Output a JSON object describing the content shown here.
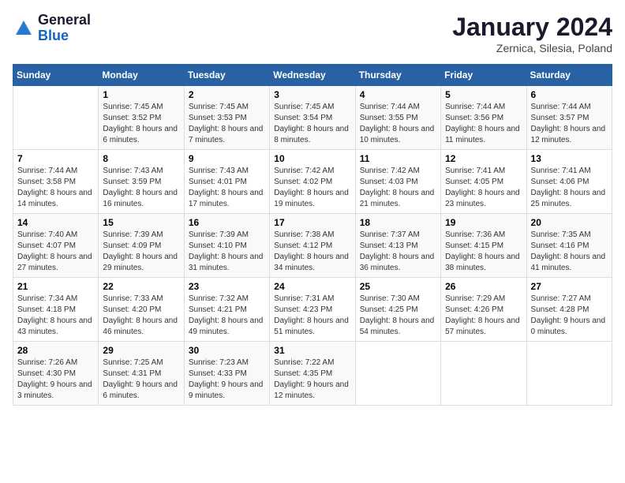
{
  "header": {
    "logo": {
      "general": "General",
      "blue": "Blue"
    },
    "title": "January 2024",
    "location": "Zernica, Silesia, Poland"
  },
  "columns": [
    "Sunday",
    "Monday",
    "Tuesday",
    "Wednesday",
    "Thursday",
    "Friday",
    "Saturday"
  ],
  "weeks": [
    [
      {
        "day": "",
        "sunrise": "",
        "sunset": "",
        "daylight": ""
      },
      {
        "day": "1",
        "sunrise": "Sunrise: 7:45 AM",
        "sunset": "Sunset: 3:52 PM",
        "daylight": "Daylight: 8 hours and 6 minutes."
      },
      {
        "day": "2",
        "sunrise": "Sunrise: 7:45 AM",
        "sunset": "Sunset: 3:53 PM",
        "daylight": "Daylight: 8 hours and 7 minutes."
      },
      {
        "day": "3",
        "sunrise": "Sunrise: 7:45 AM",
        "sunset": "Sunset: 3:54 PM",
        "daylight": "Daylight: 8 hours and 8 minutes."
      },
      {
        "day": "4",
        "sunrise": "Sunrise: 7:44 AM",
        "sunset": "Sunset: 3:55 PM",
        "daylight": "Daylight: 8 hours and 10 minutes."
      },
      {
        "day": "5",
        "sunrise": "Sunrise: 7:44 AM",
        "sunset": "Sunset: 3:56 PM",
        "daylight": "Daylight: 8 hours and 11 minutes."
      },
      {
        "day": "6",
        "sunrise": "Sunrise: 7:44 AM",
        "sunset": "Sunset: 3:57 PM",
        "daylight": "Daylight: 8 hours and 12 minutes."
      }
    ],
    [
      {
        "day": "7",
        "sunrise": "Sunrise: 7:44 AM",
        "sunset": "Sunset: 3:58 PM",
        "daylight": "Daylight: 8 hours and 14 minutes."
      },
      {
        "day": "8",
        "sunrise": "Sunrise: 7:43 AM",
        "sunset": "Sunset: 3:59 PM",
        "daylight": "Daylight: 8 hours and 16 minutes."
      },
      {
        "day": "9",
        "sunrise": "Sunrise: 7:43 AM",
        "sunset": "Sunset: 4:01 PM",
        "daylight": "Daylight: 8 hours and 17 minutes."
      },
      {
        "day": "10",
        "sunrise": "Sunrise: 7:42 AM",
        "sunset": "Sunset: 4:02 PM",
        "daylight": "Daylight: 8 hours and 19 minutes."
      },
      {
        "day": "11",
        "sunrise": "Sunrise: 7:42 AM",
        "sunset": "Sunset: 4:03 PM",
        "daylight": "Daylight: 8 hours and 21 minutes."
      },
      {
        "day": "12",
        "sunrise": "Sunrise: 7:41 AM",
        "sunset": "Sunset: 4:05 PM",
        "daylight": "Daylight: 8 hours and 23 minutes."
      },
      {
        "day": "13",
        "sunrise": "Sunrise: 7:41 AM",
        "sunset": "Sunset: 4:06 PM",
        "daylight": "Daylight: 8 hours and 25 minutes."
      }
    ],
    [
      {
        "day": "14",
        "sunrise": "Sunrise: 7:40 AM",
        "sunset": "Sunset: 4:07 PM",
        "daylight": "Daylight: 8 hours and 27 minutes."
      },
      {
        "day": "15",
        "sunrise": "Sunrise: 7:39 AM",
        "sunset": "Sunset: 4:09 PM",
        "daylight": "Daylight: 8 hours and 29 minutes."
      },
      {
        "day": "16",
        "sunrise": "Sunrise: 7:39 AM",
        "sunset": "Sunset: 4:10 PM",
        "daylight": "Daylight: 8 hours and 31 minutes."
      },
      {
        "day": "17",
        "sunrise": "Sunrise: 7:38 AM",
        "sunset": "Sunset: 4:12 PM",
        "daylight": "Daylight: 8 hours and 34 minutes."
      },
      {
        "day": "18",
        "sunrise": "Sunrise: 7:37 AM",
        "sunset": "Sunset: 4:13 PM",
        "daylight": "Daylight: 8 hours and 36 minutes."
      },
      {
        "day": "19",
        "sunrise": "Sunrise: 7:36 AM",
        "sunset": "Sunset: 4:15 PM",
        "daylight": "Daylight: 8 hours and 38 minutes."
      },
      {
        "day": "20",
        "sunrise": "Sunrise: 7:35 AM",
        "sunset": "Sunset: 4:16 PM",
        "daylight": "Daylight: 8 hours and 41 minutes."
      }
    ],
    [
      {
        "day": "21",
        "sunrise": "Sunrise: 7:34 AM",
        "sunset": "Sunset: 4:18 PM",
        "daylight": "Daylight: 8 hours and 43 minutes."
      },
      {
        "day": "22",
        "sunrise": "Sunrise: 7:33 AM",
        "sunset": "Sunset: 4:20 PM",
        "daylight": "Daylight: 8 hours and 46 minutes."
      },
      {
        "day": "23",
        "sunrise": "Sunrise: 7:32 AM",
        "sunset": "Sunset: 4:21 PM",
        "daylight": "Daylight: 8 hours and 49 minutes."
      },
      {
        "day": "24",
        "sunrise": "Sunrise: 7:31 AM",
        "sunset": "Sunset: 4:23 PM",
        "daylight": "Daylight: 8 hours and 51 minutes."
      },
      {
        "day": "25",
        "sunrise": "Sunrise: 7:30 AM",
        "sunset": "Sunset: 4:25 PM",
        "daylight": "Daylight: 8 hours and 54 minutes."
      },
      {
        "day": "26",
        "sunrise": "Sunrise: 7:29 AM",
        "sunset": "Sunset: 4:26 PM",
        "daylight": "Daylight: 8 hours and 57 minutes."
      },
      {
        "day": "27",
        "sunrise": "Sunrise: 7:27 AM",
        "sunset": "Sunset: 4:28 PM",
        "daylight": "Daylight: 9 hours and 0 minutes."
      }
    ],
    [
      {
        "day": "28",
        "sunrise": "Sunrise: 7:26 AM",
        "sunset": "Sunset: 4:30 PM",
        "daylight": "Daylight: 9 hours and 3 minutes."
      },
      {
        "day": "29",
        "sunrise": "Sunrise: 7:25 AM",
        "sunset": "Sunset: 4:31 PM",
        "daylight": "Daylight: 9 hours and 6 minutes."
      },
      {
        "day": "30",
        "sunrise": "Sunrise: 7:23 AM",
        "sunset": "Sunset: 4:33 PM",
        "daylight": "Daylight: 9 hours and 9 minutes."
      },
      {
        "day": "31",
        "sunrise": "Sunrise: 7:22 AM",
        "sunset": "Sunset: 4:35 PM",
        "daylight": "Daylight: 9 hours and 12 minutes."
      },
      {
        "day": "",
        "sunrise": "",
        "sunset": "",
        "daylight": ""
      },
      {
        "day": "",
        "sunrise": "",
        "sunset": "",
        "daylight": ""
      },
      {
        "day": "",
        "sunrise": "",
        "sunset": "",
        "daylight": ""
      }
    ]
  ]
}
